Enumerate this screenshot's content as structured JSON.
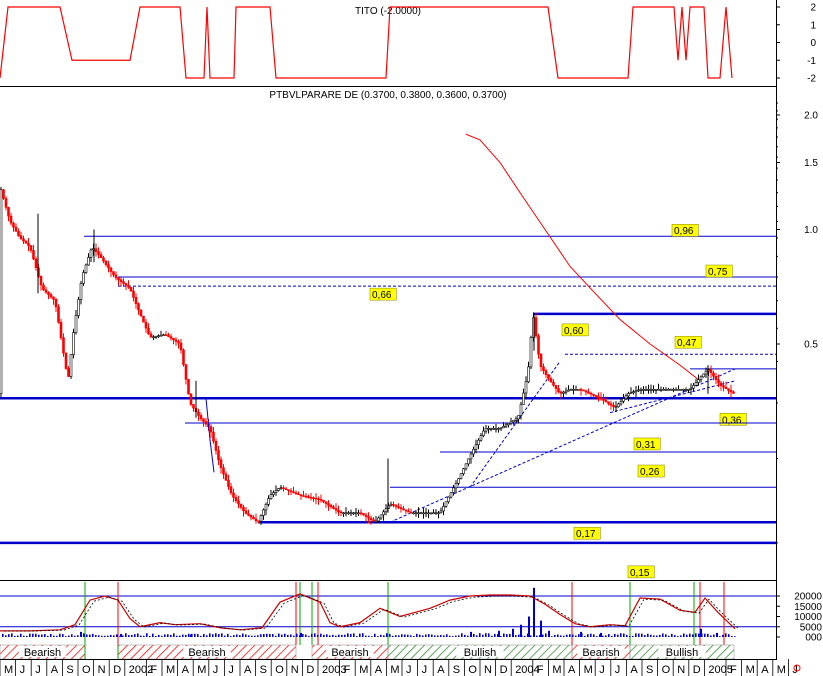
{
  "chart_data": [
    {
      "panel": "indicator",
      "type": "line",
      "title": "TITO (-2.0000)",
      "yticks": [
        "2",
        "1",
        "0",
        "-1",
        "-2"
      ],
      "ylim": [
        -2,
        2
      ],
      "series": [
        {
          "color": "#ff0000",
          "points": [
            [
              0,
              -2
            ],
            [
              8,
              2
            ],
            [
              60,
              2
            ],
            [
              72,
              -1
            ],
            [
              130,
              -1
            ],
            [
              140,
              2
            ],
            [
              180,
              2
            ],
            [
              186,
              -2
            ],
            [
              204,
              -2
            ],
            [
              207,
              2
            ],
            [
              210,
              -2
            ],
            [
              234,
              -2
            ],
            [
              236,
              2
            ],
            [
              264,
              2
            ],
            [
              270,
              2
            ],
            [
              276,
              -2
            ],
            [
              386,
              -2
            ],
            [
              390,
              2
            ],
            [
              548,
              2
            ],
            [
              558,
              -2
            ],
            [
              628,
              -2
            ],
            [
              633,
              2
            ],
            [
              674,
              2
            ],
            [
              678,
              -1
            ],
            [
              682,
              2
            ],
            [
              686,
              -1
            ],
            [
              690,
              2
            ],
            [
              704,
              2
            ],
            [
              708,
              -2
            ],
            [
              720,
              -2
            ],
            [
              726,
              2
            ],
            [
              732,
              -2
            ]
          ]
        }
      ]
    },
    {
      "panel": "price",
      "type": "candlestick",
      "title": "PTBVLPARARE DE (0.3700, 0.3800, 0.3600, 0.3700)",
      "scale": "log",
      "ylim": [
        0.135,
        2.35
      ],
      "yticks": [
        "2.0",
        "1.5",
        "1.0",
        "0.5"
      ],
      "price_path": [
        [
          0,
          1.3
        ],
        [
          10,
          1.05
        ],
        [
          20,
          0.95
        ],
        [
          30,
          0.9
        ],
        [
          42,
          0.7
        ],
        [
          55,
          0.65
        ],
        [
          68,
          0.4
        ],
        [
          74,
          0.55
        ],
        [
          82,
          0.75
        ],
        [
          92,
          0.9
        ],
        [
          100,
          0.85
        ],
        [
          115,
          0.75
        ],
        [
          130,
          0.7
        ],
        [
          140,
          0.6
        ],
        [
          150,
          0.52
        ],
        [
          165,
          0.53
        ],
        [
          180,
          0.5
        ],
        [
          190,
          0.35
        ],
        [
          200,
          0.32
        ],
        [
          210,
          0.3
        ],
        [
          220,
          0.24
        ],
        [
          232,
          0.2
        ],
        [
          245,
          0.18
        ],
        [
          258,
          0.17
        ],
        [
          270,
          0.2
        ],
        [
          280,
          0.21
        ],
        [
          300,
          0.2
        ],
        [
          320,
          0.195
        ],
        [
          340,
          0.18
        ],
        [
          360,
          0.18
        ],
        [
          375,
          0.17
        ],
        [
          390,
          0.19
        ],
        [
          410,
          0.18
        ],
        [
          440,
          0.18
        ],
        [
          458,
          0.22
        ],
        [
          472,
          0.26
        ],
        [
          485,
          0.3
        ],
        [
          500,
          0.3
        ],
        [
          518,
          0.32
        ],
        [
          528,
          0.42
        ],
        [
          533,
          0.6
        ],
        [
          540,
          0.44
        ],
        [
          550,
          0.4
        ],
        [
          560,
          0.37
        ],
        [
          570,
          0.38
        ],
        [
          580,
          0.38
        ],
        [
          600,
          0.36
        ],
        [
          615,
          0.34
        ],
        [
          628,
          0.37
        ],
        [
          640,
          0.38
        ],
        [
          660,
          0.38
        ],
        [
          690,
          0.38
        ],
        [
          708,
          0.43
        ],
        [
          720,
          0.39
        ],
        [
          734,
          0.37
        ]
      ],
      "moving_average": [
        [
          466,
          1.78
        ],
        [
          480,
          1.72
        ],
        [
          500,
          1.5
        ],
        [
          520,
          1.25
        ],
        [
          545,
          1.0
        ],
        [
          570,
          0.8
        ],
        [
          595,
          0.68
        ],
        [
          620,
          0.58
        ],
        [
          650,
          0.5
        ],
        [
          680,
          0.44
        ],
        [
          700,
          0.4
        ]
      ],
      "horizontal_levels": [
        {
          "value": 0.96,
          "label": "0,96"
        },
        {
          "value": 0.75,
          "label": "0,75"
        },
        {
          "value": 0.71,
          "style": "dashed"
        },
        {
          "value": 0.66,
          "label": "0,66"
        },
        {
          "value": 0.6,
          "label": "0,60",
          "style": "bold"
        },
        {
          "value": 0.47,
          "style": "dashed",
          "label": "0,47"
        },
        {
          "value": 0.43
        },
        {
          "value": 0.36,
          "label": "0,36",
          "style": "bold"
        },
        {
          "value": 0.31,
          "label": "0,31"
        },
        {
          "value": 0.26,
          "label": "0,26"
        },
        {
          "value": 0.21
        },
        {
          "value": 0.17,
          "label": "0,17",
          "style": "bold"
        },
        {
          "value": 0.15,
          "label": "0,15",
          "style": "bold"
        }
      ],
      "labels": [
        "0,96",
        "0,75",
        "0,66",
        "0,60",
        "0,47",
        "0,36",
        "0,31",
        "0,26",
        "0,17",
        "0,15"
      ]
    },
    {
      "panel": "volume",
      "type": "bar",
      "yticks": [
        "20000",
        "15000",
        "10000",
        "5000",
        "000"
      ],
      "ylim": [
        0,
        24000
      ],
      "oscillator": [
        [
          0,
          3000
        ],
        [
          30,
          3000
        ],
        [
          60,
          3500
        ],
        [
          75,
          6000
        ],
        [
          90,
          18000
        ],
        [
          105,
          20000
        ],
        [
          118,
          18000
        ],
        [
          130,
          9000
        ],
        [
          140,
          5000
        ],
        [
          160,
          7000
        ],
        [
          175,
          6000
        ],
        [
          200,
          6500
        ],
        [
          220,
          4500
        ],
        [
          240,
          3500
        ],
        [
          262,
          4500
        ],
        [
          280,
          17000
        ],
        [
          300,
          21000
        ],
        [
          320,
          17000
        ],
        [
          330,
          7000
        ],
        [
          340,
          5000
        ],
        [
          360,
          7000
        ],
        [
          380,
          14000
        ],
        [
          400,
          10000
        ],
        [
          430,
          14000
        ],
        [
          450,
          18000
        ],
        [
          470,
          20000
        ],
        [
          490,
          20500
        ],
        [
          510,
          20500
        ],
        [
          530,
          20000
        ],
        [
          545,
          16000
        ],
        [
          560,
          11000
        ],
        [
          575,
          6500
        ],
        [
          590,
          5000
        ],
        [
          610,
          6000
        ],
        [
          625,
          5500
        ],
        [
          640,
          19000
        ],
        [
          660,
          18500
        ],
        [
          680,
          13000
        ],
        [
          695,
          12000
        ],
        [
          705,
          19000
        ],
        [
          718,
          12000
        ],
        [
          735,
          4000
        ]
      ],
      "volume_bars": [
        [
          80,
          2500
        ],
        [
          120,
          1500
        ],
        [
          190,
          1200
        ],
        [
          300,
          2000
        ],
        [
          470,
          2500
        ],
        [
          498,
          3000
        ],
        [
          512,
          4000
        ],
        [
          520,
          6000
        ],
        [
          528,
          10000
        ],
        [
          533,
          24000
        ],
        [
          540,
          8000
        ],
        [
          548,
          3000
        ],
        [
          580,
          2500
        ],
        [
          600,
          2000
        ],
        [
          700,
          4000
        ],
        [
          716,
          2000
        ]
      ]
    }
  ],
  "signals": [
    {
      "label": "Bearish"
    },
    {
      "label": "Bearish"
    },
    {
      "label": "Bearish"
    },
    {
      "label": "Bullish"
    },
    {
      "label": "Bearish"
    },
    {
      "label": "Bullish"
    }
  ],
  "x_axis": {
    "labels": [
      "M",
      "J",
      "J",
      "A",
      "S",
      "O",
      "N",
      "D",
      "2002",
      "F",
      "M",
      "A",
      "M",
      "J",
      "J",
      "A",
      "S",
      "O",
      "N",
      "D",
      "2003",
      "F",
      "M",
      "A",
      "M",
      "J",
      "J",
      "A",
      "S",
      "O",
      "N",
      "D",
      "2004",
      "F",
      "M",
      "A",
      "M",
      "J",
      "J",
      "A",
      "S",
      "O",
      "N",
      "D",
      "2005",
      "F",
      "M",
      "A",
      "M",
      "J"
    ]
  },
  "colors": {
    "up": "#000000",
    "down": "#ff0000",
    "level": "#0000cc",
    "label_bg": "#ffff00",
    "ma": "#ff0000",
    "bullish_hatch": "#2e8b2e",
    "bearish_hatch": "#ff0000",
    "volume": "#0000cc"
  }
}
